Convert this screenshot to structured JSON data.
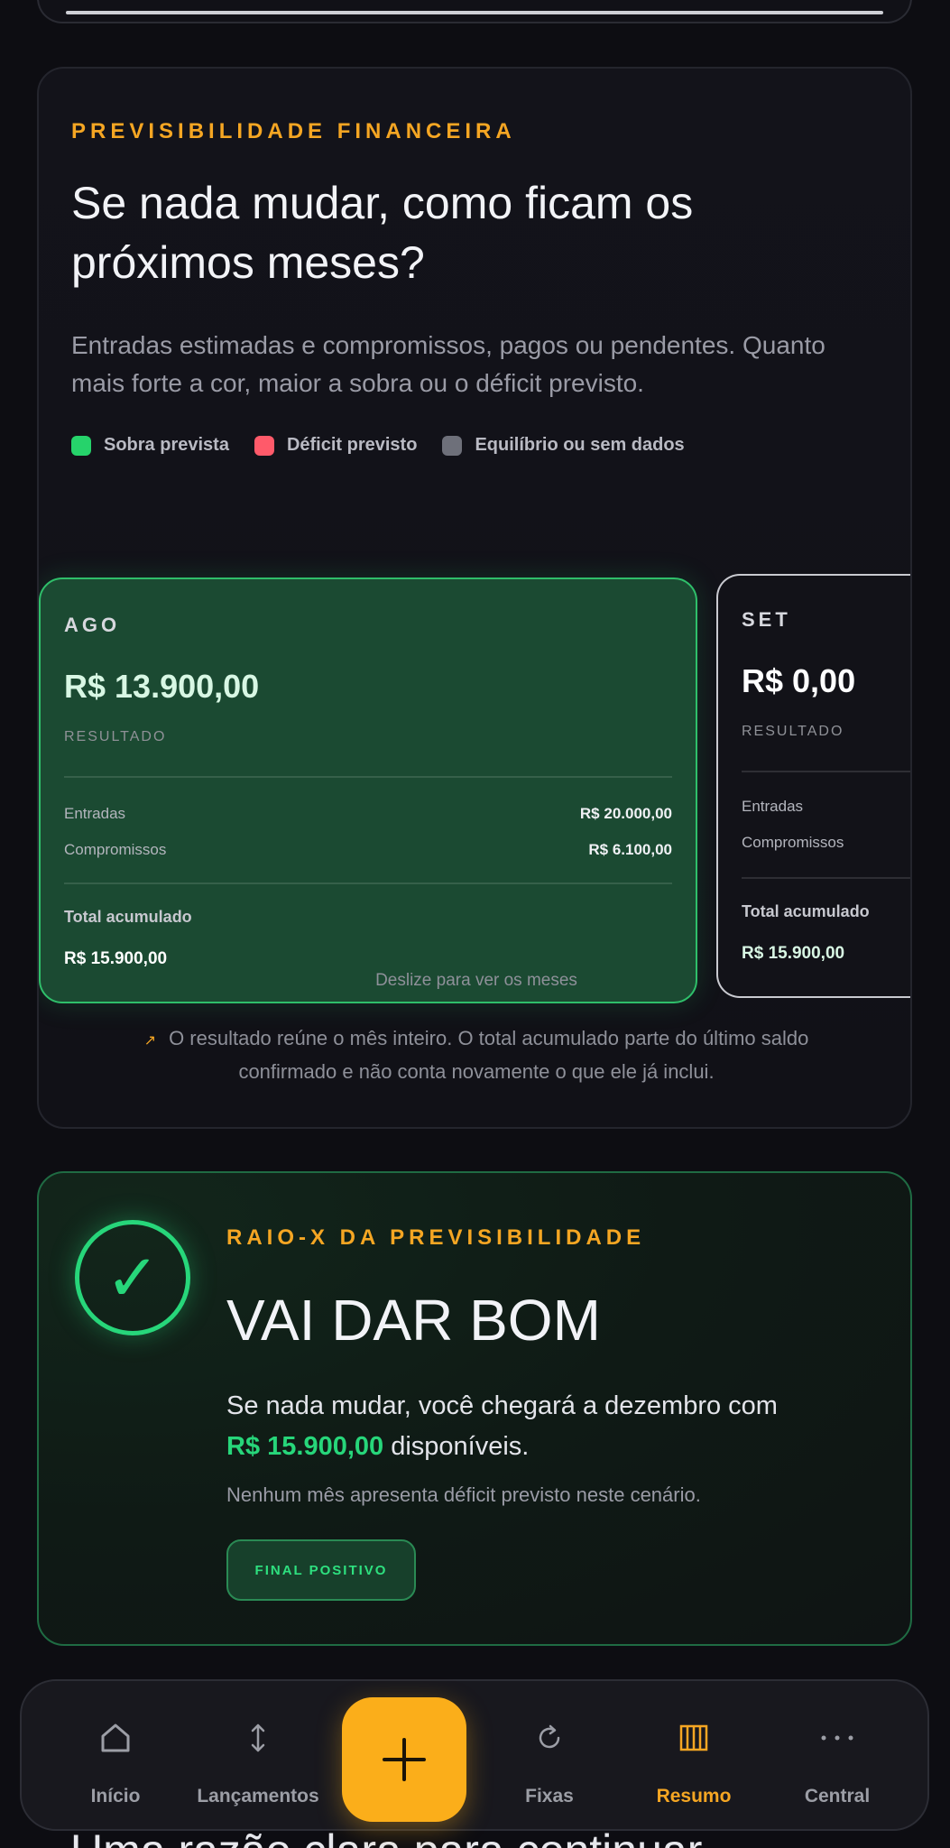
{
  "forecast": {
    "eyebrow": "PREVISIBILIDADE FINANCEIRA",
    "title": "Se nada mudar, como ficam os próximos meses?",
    "description": "Entradas estimadas e compromissos, pagos ou pendentes. Quanto mais forte a cor, maior a sobra ou o déficit previsto.",
    "legend": [
      {
        "label": "Sobra prevista",
        "color": "#26d36b"
      },
      {
        "label": "Déficit previsto",
        "color": "#ff5a6a"
      },
      {
        "label": "Equilíbrio ou sem dados",
        "color": "#6e707a"
      }
    ],
    "months": [
      {
        "name": "AGO",
        "result": "R$ 13.900,00",
        "result_label": "RESULTADO",
        "income_label": "Entradas",
        "income": "R$ 20.000,00",
        "commitments_label": "Compromissos",
        "commitments": "R$ 6.100,00",
        "total_label": "Total acumulado",
        "total": "R$ 15.900,00"
      },
      {
        "name": "SET",
        "result": "R$ 0,00",
        "result_label": "RESULTADO",
        "income_label": "Entradas",
        "commitments_label": "Compromissos",
        "total_label": "Total acumulado",
        "total": "R$ 15.900,00"
      }
    ],
    "swipe_hint": "Deslize para ver os meses",
    "note": "O resultado reúne o mês inteiro. O total acumulado parte do último saldo confirmado e não conta novamente o que ele já inclui."
  },
  "raiox": {
    "eyebrow": "RAIO-X DA PREVISIBILIDADE",
    "title": "VAI DAR BOM",
    "text_before": "Se nada mudar, você chegará a dezembro com",
    "amount": "R$ 15.900,00",
    "text_after": "disponíveis.",
    "subtitle": "Nenhum mês apresenta déficit previsto neste cenário.",
    "badge": "FINAL POSITIVO"
  },
  "behind_text": "Uma razão clara para continuar",
  "nav": {
    "items": [
      {
        "label": "Início",
        "icon": "home-icon"
      },
      {
        "label": "Lançamentos",
        "icon": "arrows-updown-icon"
      },
      {
        "label": "Fixas",
        "icon": "refresh-icon"
      },
      {
        "label": "Resumo",
        "icon": "columns-icon"
      },
      {
        "label": "Central",
        "icon": "more-icon"
      }
    ],
    "active": "Resumo"
  },
  "colors": {
    "accent": "#f5a623",
    "positive": "#27d67a",
    "negative": "#ff5a6a"
  }
}
